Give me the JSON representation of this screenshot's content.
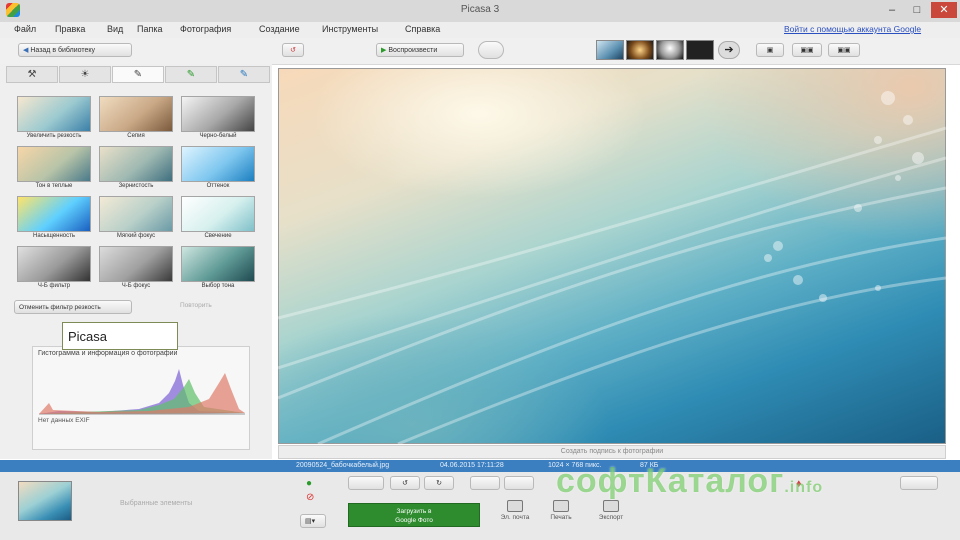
{
  "window": {
    "title": "Picasa 3",
    "minimize": "–",
    "maximize": "□",
    "close": "✕"
  },
  "menu": [
    "Файл",
    "Правка",
    "Вид",
    "Папка",
    "Фотография",
    "Создание",
    "Инструменты",
    "Справка"
  ],
  "signin_link": "Войти с помощью аккаунта Google",
  "toolbar": {
    "back_label": "Назад в библиотеку",
    "slideshow_label": "Воспроизвести"
  },
  "tabs": [
    "wrench",
    "sun",
    "brush",
    "brush-green",
    "brush-blue"
  ],
  "effects": [
    {
      "label": "Увеличить резкость"
    },
    {
      "label": "Сепия"
    },
    {
      "label": "Черно-белый"
    },
    {
      "label": "Тон в теплые"
    },
    {
      "label": "Зернистость"
    },
    {
      "label": "Оттенок"
    },
    {
      "label": "Насыщенность"
    },
    {
      "label": "Мягкий фокус"
    },
    {
      "label": "Свечение"
    },
    {
      "label": "Ч-Б фильтр"
    },
    {
      "label": "Ч-Б фокус"
    },
    {
      "label": "Выбор тона"
    }
  ],
  "panel_buttons": {
    "apply_label": "Отменить фильтр резкость",
    "repeat_label": "Повторить"
  },
  "overlay_label": "Picasa",
  "histogram": {
    "title": "Гистограмма и информация о фотографии",
    "exif_label": "Нет данных EXIF"
  },
  "caption_placeholder": "Создать подпись к фотографии",
  "status": {
    "filename": "20090524_бабочкабелый.jpg",
    "date": "04.06.2015 17:11:28",
    "size": "1024 × 768 пикс.",
    "filesize": "87 КБ"
  },
  "tray": {
    "selected_text": "Выбранные элементы",
    "upload_label_line1": "Загрузить в",
    "upload_label_line2": "Google Фото",
    "email_label": "Эл. почта",
    "print_label": "Печать",
    "export_label": "Экспорт"
  },
  "watermark": {
    "text": "софтКаталог",
    "suffix": ".info"
  }
}
